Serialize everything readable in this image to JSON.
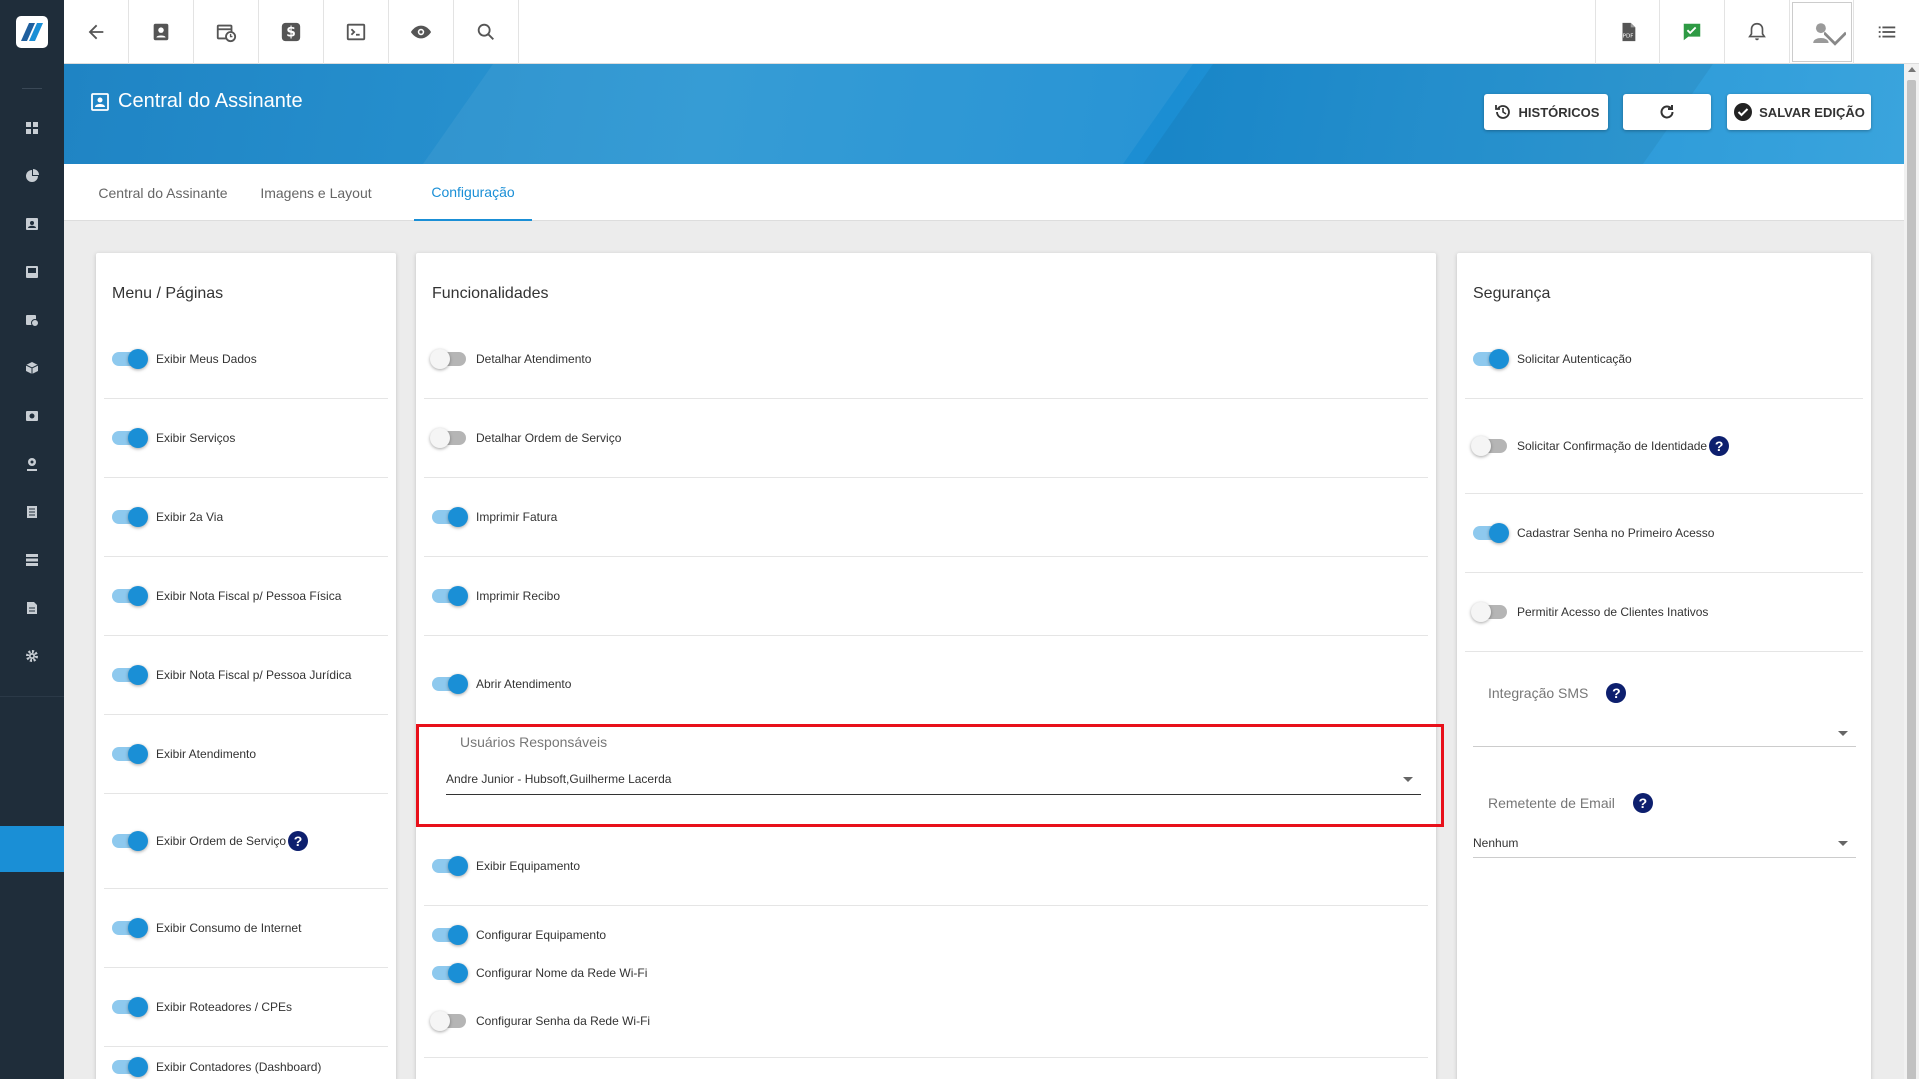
{
  "header": {
    "title": "Central do Assinante",
    "btn_historicos": "HISTÓRICOS",
    "btn_salvar": "SALVAR EDIÇÃO"
  },
  "tabs": [
    {
      "label": "Central do Assinante"
    },
    {
      "label": "Imagens e Layout"
    },
    {
      "label": "Configuração"
    }
  ],
  "menu": {
    "title": "Menu / Páginas",
    "items": [
      {
        "label": "Exibir Meus Dados",
        "on": true
      },
      {
        "label": "Exibir Serviços",
        "on": true
      },
      {
        "label": "Exibir 2a Via",
        "on": true
      },
      {
        "label": "Exibir Nota Fiscal p/ Pessoa Física",
        "on": true
      },
      {
        "label": "Exibir Nota Fiscal p/ Pessoa Jurídica",
        "on": true
      },
      {
        "label": "Exibir Atendimento",
        "on": true
      },
      {
        "label": "Exibir Ordem de Serviço",
        "on": true
      },
      {
        "label": "Exibir Consumo de Internet",
        "on": true
      },
      {
        "label": "Exibir Roteadores / CPEs",
        "on": true
      },
      {
        "label": "Exibir Contadores (Dashboard)",
        "on": true
      }
    ]
  },
  "func": {
    "title": "Funcionalidades",
    "items": [
      {
        "label": "Detalhar Atendimento",
        "on": false
      },
      {
        "label": "Detalhar Ordem de Serviço",
        "on": false
      },
      {
        "label": "Imprimir Fatura",
        "on": true
      },
      {
        "label": "Imprimir Recibo",
        "on": true
      },
      {
        "label": "Abrir Atendimento",
        "on": true
      },
      {
        "label": "Exibir Equipamento",
        "on": true
      },
      {
        "label": "Configurar Equipamento",
        "on": true
      },
      {
        "label": "Configurar Nome da Rede Wi-Fi",
        "on": true
      },
      {
        "label": "Configurar Senha da Rede Wi-Fi",
        "on": false
      }
    ],
    "users_label": "Usuários Responsáveis",
    "users_value": "Andre Junior - Hubsoft,Guilherme Lacerda"
  },
  "security": {
    "title": "Segurança",
    "items": [
      {
        "label": "Solicitar Autenticação",
        "on": true
      },
      {
        "label": "Solicitar Confirmação de Identidade",
        "on": false
      },
      {
        "label": "Cadastrar Senha no Primeiro Acesso",
        "on": true
      },
      {
        "label": "Permitir Acesso de Clientes Inativos",
        "on": false
      }
    ],
    "sms_label": "Integração SMS",
    "sms_value": "",
    "email_label": "Remetente de Email",
    "email_value": "Nenhum"
  },
  "help_glyph": "?",
  "colors": {
    "accent": "#1a8fd6",
    "sidebar": "#1f2d3a",
    "highlight": "#e8101a",
    "help": "#0d1f6e"
  }
}
